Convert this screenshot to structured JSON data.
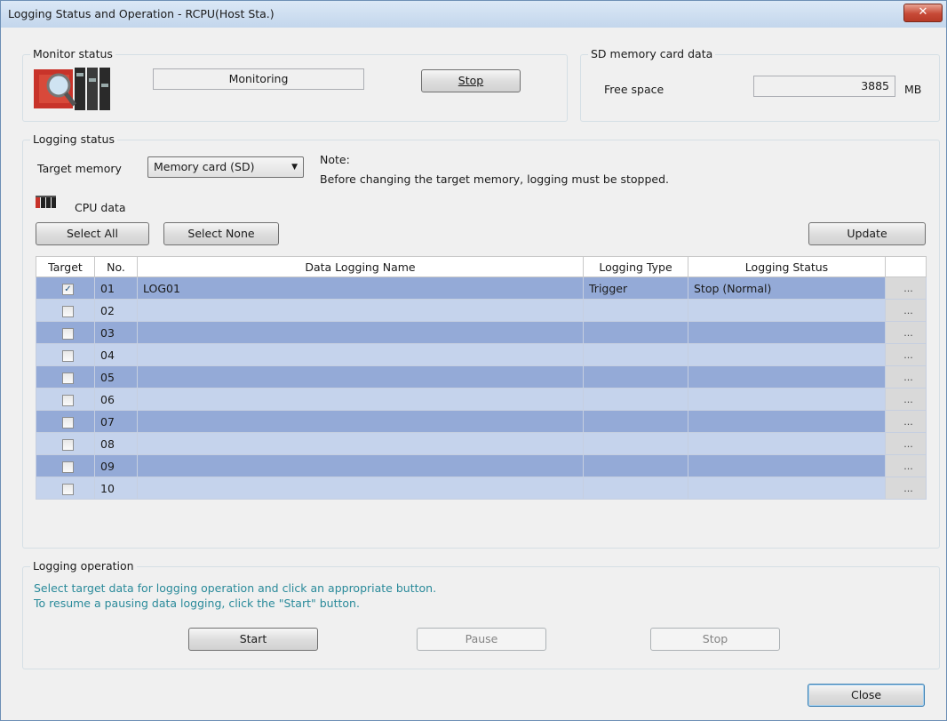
{
  "window": {
    "title": "Logging Status and Operation - RCPU(Host Sta.)",
    "close_glyph": "✕"
  },
  "monitor": {
    "label": "Monitor status",
    "status_text": "Monitoring",
    "stop_label": "Stop"
  },
  "sd": {
    "label": "SD memory card data",
    "free_label": "Free space",
    "free_value": "3885",
    "unit": "MB"
  },
  "logging_status": {
    "label": "Logging status",
    "target_label": "Target memory",
    "target_value": "Memory card (SD)",
    "note_title": "Note:",
    "note_body": "Before changing the target memory, logging must be stopped.",
    "cpu_label": "CPU data",
    "select_all": "Select All",
    "select_none": "Select None",
    "update": "Update"
  },
  "table": {
    "headers": [
      "Target",
      "No.",
      "Data Logging Name",
      "Logging Type",
      "Logging Status",
      ""
    ],
    "rows": [
      {
        "checked": true,
        "no": "01",
        "name": "LOG01",
        "type": "Trigger",
        "status": "Stop (Normal)"
      },
      {
        "checked": false,
        "no": "02",
        "name": "",
        "type": "",
        "status": ""
      },
      {
        "checked": false,
        "no": "03",
        "name": "",
        "type": "",
        "status": ""
      },
      {
        "checked": false,
        "no": "04",
        "name": "",
        "type": "",
        "status": ""
      },
      {
        "checked": false,
        "no": "05",
        "name": "",
        "type": "",
        "status": ""
      },
      {
        "checked": false,
        "no": "06",
        "name": "",
        "type": "",
        "status": ""
      },
      {
        "checked": false,
        "no": "07",
        "name": "",
        "type": "",
        "status": ""
      },
      {
        "checked": false,
        "no": "08",
        "name": "",
        "type": "",
        "status": ""
      },
      {
        "checked": false,
        "no": "09",
        "name": "",
        "type": "",
        "status": ""
      },
      {
        "checked": false,
        "no": "10",
        "name": "",
        "type": "",
        "status": ""
      }
    ],
    "dots": "..."
  },
  "operation": {
    "label": "Logging operation",
    "info1": "Select target data for logging operation and click an appropriate button.",
    "info2": "To resume a pausing data logging, click the \"Start\" button.",
    "start": "Start",
    "pause": "Pause",
    "stop": "Stop"
  },
  "close_label": "Close",
  "colors": {
    "row_odd": "#94aad7",
    "row_even": "#c5d3ec",
    "info_text": "#2a8a9a"
  }
}
